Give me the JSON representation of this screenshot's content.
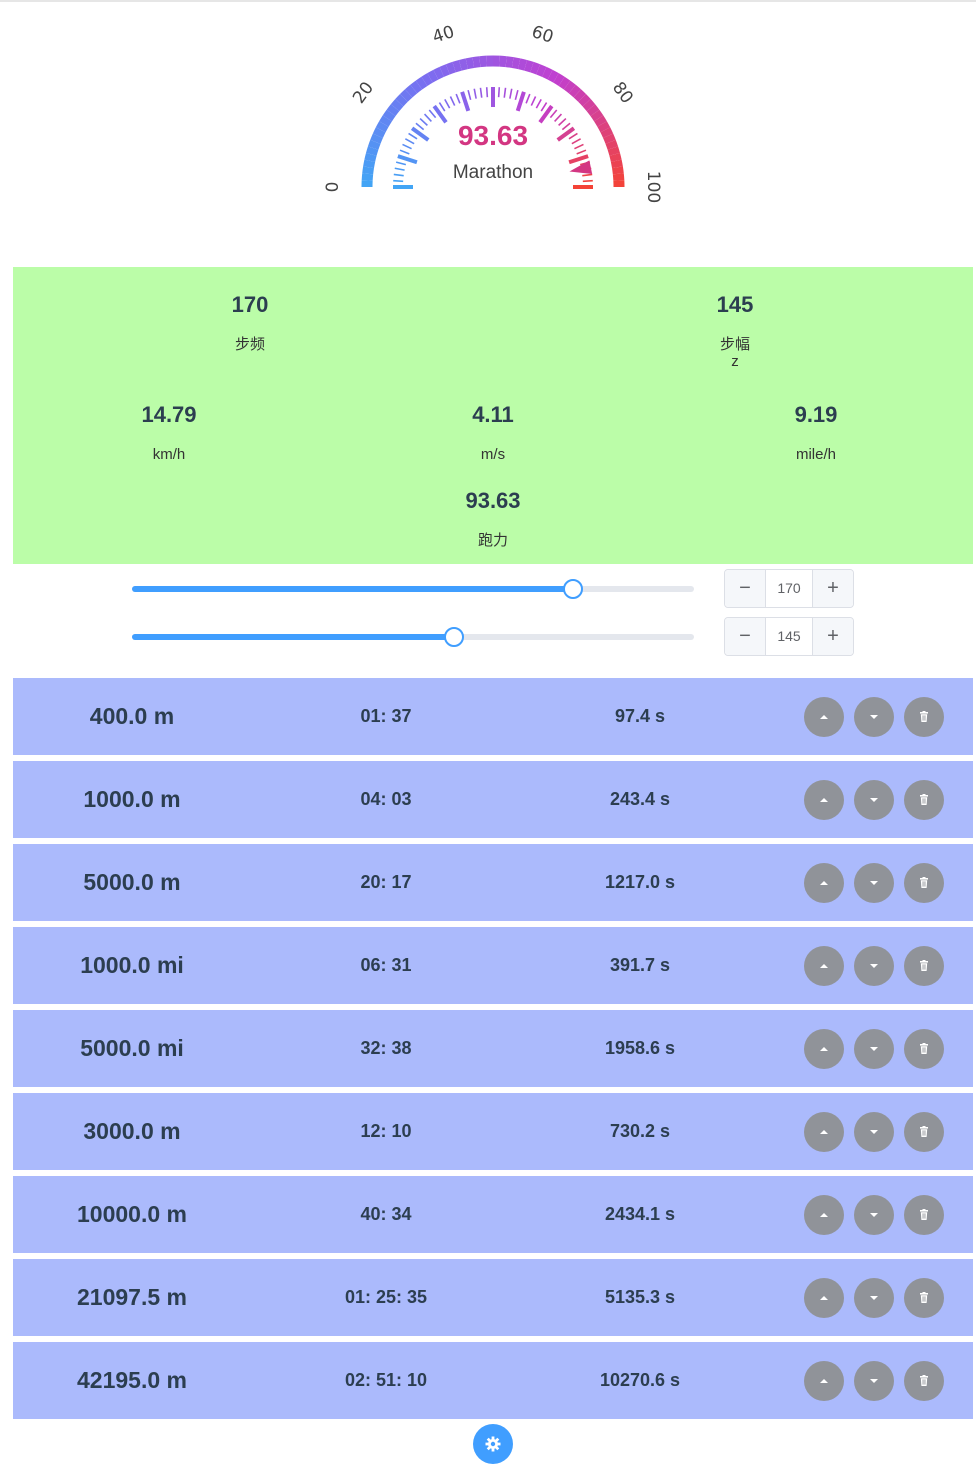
{
  "gauge": {
    "value": "93.63",
    "label": "Marathon",
    "min": 0,
    "max": 100,
    "reading": 93.63,
    "tick_labels": [
      "0",
      "20",
      "40",
      "60",
      "80",
      "100"
    ],
    "gradient": [
      "#42a5f5",
      "#7c6cf0",
      "#c13fd0",
      "#f44336"
    ]
  },
  "stats": {
    "cadence": {
      "value": "170",
      "label": "步频"
    },
    "stride": {
      "value": "145",
      "label": "步幅",
      "sublabel": "z"
    },
    "kmh": {
      "value": "14.79",
      "label": "km/h"
    },
    "ms": {
      "value": "4.11",
      "label": "m/s"
    },
    "mileh": {
      "value": "9.19",
      "label": "mile/h"
    },
    "power": {
      "value": "93.63",
      "label": "跑力"
    },
    "background": "#bbfda8"
  },
  "sliders": [
    {
      "name": "cadence",
      "value": "170",
      "fraction": 0.785,
      "minus": "−",
      "plus": "+"
    },
    {
      "name": "stride",
      "value": "145",
      "fraction": 0.573,
      "minus": "−",
      "plus": "+"
    }
  ],
  "rows": [
    {
      "distance": "400.0 m",
      "time": "01: 37",
      "seconds": "97.4 s"
    },
    {
      "distance": "1000.0 m",
      "time": "04: 03",
      "seconds": "243.4 s"
    },
    {
      "distance": "5000.0 m",
      "time": "20: 17",
      "seconds": "1217.0 s"
    },
    {
      "distance": "1000.0 mi",
      "time": "06: 31",
      "seconds": "391.7 s"
    },
    {
      "distance": "5000.0 mi",
      "time": "32: 38",
      "seconds": "1958.6 s"
    },
    {
      "distance": "3000.0 m",
      "time": "12: 10",
      "seconds": "730.2 s"
    },
    {
      "distance": "10000.0 m",
      "time": "40: 34",
      "seconds": "2434.1 s"
    },
    {
      "distance": "21097.5 m",
      "time": "01: 25: 35",
      "seconds": "5135.3 s"
    },
    {
      "distance": "42195.0 m",
      "time": "02: 51: 10",
      "seconds": "10270.6 s"
    }
  ],
  "row_icons": [
    "chevron-up-icon",
    "chevron-down-icon",
    "trash-icon"
  ],
  "settings_icon": "gear-icon",
  "colors": {
    "accent": "#409eff",
    "row_bg": "#abbafc",
    "action_btn": "#909399"
  }
}
